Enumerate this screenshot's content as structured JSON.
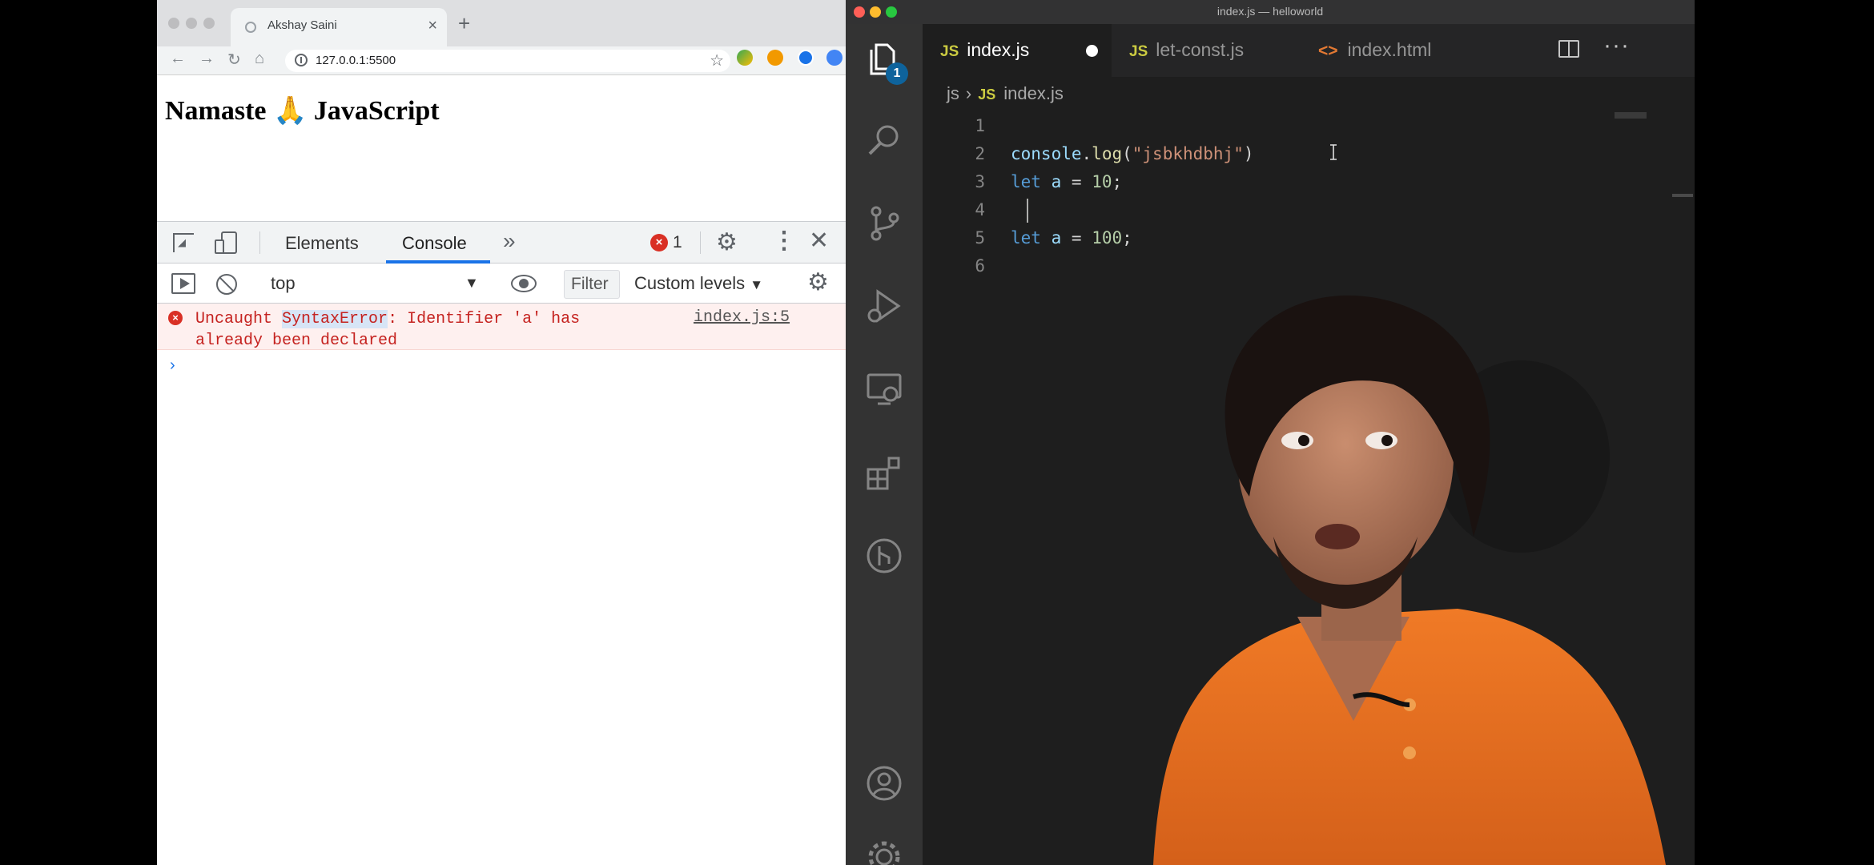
{
  "browser": {
    "tab_title": "Akshay Saini",
    "url": "127.0.0.1:5500",
    "page_heading": "Namaste 🙏 JavaScript",
    "devtools": {
      "tabs": [
        "Elements",
        "Console"
      ],
      "active_tab": "Console",
      "error_count": "1",
      "context": "top",
      "filter_placeholder": "Filter",
      "levels": "Custom levels",
      "error": {
        "prefix": "Uncaught ",
        "type": "SyntaxError",
        "message": ": Identifier 'a' has already been declared",
        "source": "index.js:5"
      },
      "prompt": "›"
    },
    "icons": [
      "back-icon",
      "forward-icon",
      "reload-icon",
      "home-icon",
      "lock-icon",
      "star-icon",
      "extension-icon"
    ]
  },
  "vscode": {
    "window_title": "index.js — helloworld",
    "explorer_badge": "1",
    "tabs": [
      {
        "icon": "JS",
        "label": "index.js",
        "modified": true
      },
      {
        "icon": "JS",
        "label": "let-const.js"
      },
      {
        "icon": "<>",
        "label": "index.html"
      }
    ],
    "breadcrumb": {
      "folder": "js",
      "icon": "JS",
      "file": "index.js"
    },
    "lines": [
      {
        "n": "1",
        "tokens": []
      },
      {
        "n": "2",
        "tokens": [
          [
            "obj",
            "console"
          ],
          [
            "punc",
            "."
          ],
          [
            "fn",
            "log"
          ],
          [
            "punc",
            "("
          ],
          [
            "str",
            "\"jsbkhdbhj\""
          ],
          [
            "punc",
            ")"
          ]
        ]
      },
      {
        "n": "3",
        "tokens": [
          [
            "kw",
            "let"
          ],
          [
            "punc",
            " "
          ],
          [
            "var",
            "a"
          ],
          [
            "punc",
            " = "
          ],
          [
            "num",
            "10"
          ],
          [
            "punc",
            ";"
          ]
        ]
      },
      {
        "n": "4",
        "tokens": []
      },
      {
        "n": "5",
        "tokens": [
          [
            "kw",
            "let"
          ],
          [
            "punc",
            " "
          ],
          [
            "var",
            "a"
          ],
          [
            "punc",
            " = "
          ],
          [
            "num",
            "100"
          ],
          [
            "punc",
            ";"
          ]
        ]
      },
      {
        "n": "6",
        "tokens": []
      }
    ],
    "colors": {
      "bg": "#1e1e1e",
      "activity": "#333333",
      "badge": "#0e639c"
    }
  }
}
